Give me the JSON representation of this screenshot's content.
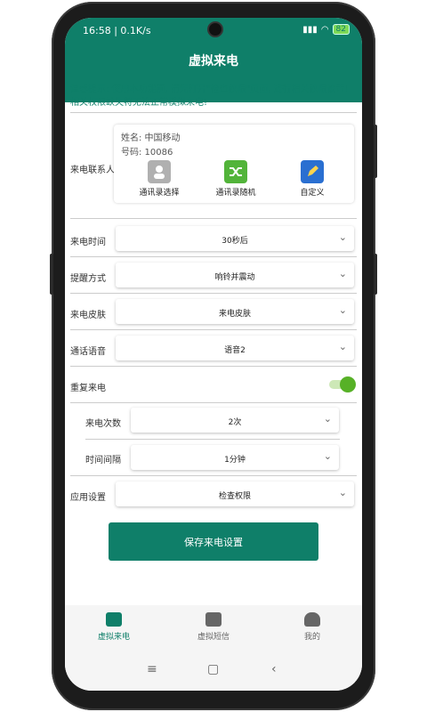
{
  "status": {
    "time_net": "16:58 | 0.1K/s",
    "battery": "82"
  },
  "app": {
    "title": "虚拟来电",
    "accent": "#0f7f69",
    "toggle_color": "#57b127"
  },
  "tip": "温馨提示: 使用本功能前, 请先打开\"检查权限\"页面, 进行相关权限设置! 相关权限缺失将无法正常模拟来电!",
  "contact": {
    "label": "来电联系人",
    "name_line": "姓名: 中国移动",
    "number_line": "号码: 10086",
    "buttons": [
      {
        "label": "通讯录选择",
        "icon": "contacts-icon"
      },
      {
        "label": "通讯录随机",
        "icon": "shuffle-icon"
      },
      {
        "label": "自定义",
        "icon": "edit-icon"
      }
    ]
  },
  "fields": [
    {
      "label": "来电时间",
      "value": "30秒后"
    },
    {
      "label": "提醒方式",
      "value": "响铃并震动"
    },
    {
      "label": "来电皮肤",
      "value": "来电皮肤"
    },
    {
      "label": "通话语音",
      "value": "语音2"
    }
  ],
  "repeat": {
    "label": "重复来电",
    "enabled": true
  },
  "repeat_fields": [
    {
      "label": "来电次数",
      "value": "2次"
    },
    {
      "label": "时间间隔",
      "value": "1分钟"
    }
  ],
  "app_setting": {
    "label": "应用设置",
    "value": "检查权限"
  },
  "save_label": "保存来电设置",
  "nav": [
    {
      "label": "虚拟来电",
      "active": true
    },
    {
      "label": "虚拟短信",
      "active": false
    },
    {
      "label": "我的",
      "active": false
    }
  ]
}
